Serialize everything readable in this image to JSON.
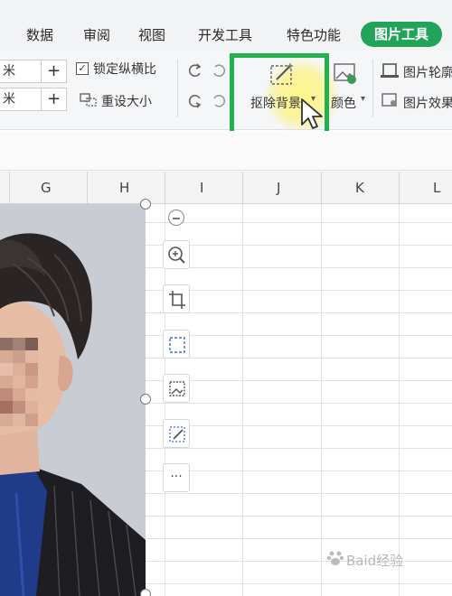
{
  "ribbon_tabs": {
    "data": "数据",
    "review": "审阅",
    "view": "视图",
    "developer": "开发工具",
    "features": "特色功能",
    "picture_tools": "图片工具"
  },
  "size_controls": {
    "unit_top": "米",
    "unit_bottom": "米",
    "plus": "+",
    "lock_ratio_label": "锁定纵横比",
    "lock_ratio_checked": true,
    "reset_size_label": "重设大小"
  },
  "tools": {
    "remove_background_label": "抠除背景",
    "color_label": "颜色",
    "picture_border_label": "图片轮廓",
    "picture_effects_label": "图片效果"
  },
  "columns": [
    "G",
    "H",
    "I",
    "J",
    "K",
    "L"
  ],
  "float_toolbar": {
    "more_label": "···"
  },
  "watermark": "Baid经验",
  "colors": {
    "accent_green": "#22a35a",
    "highlight_green": "#23b14d"
  }
}
